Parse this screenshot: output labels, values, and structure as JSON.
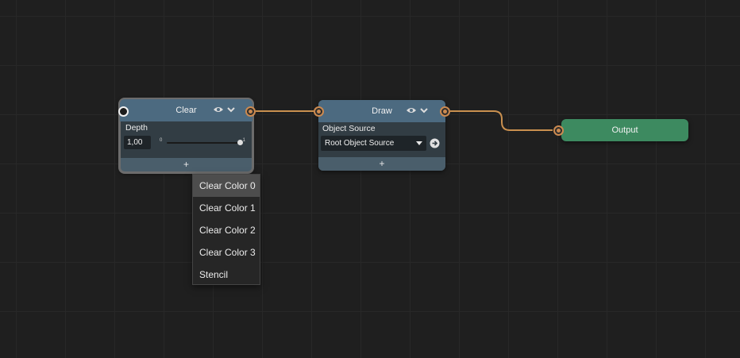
{
  "nodes": {
    "clear": {
      "title": "Clear",
      "depth_label": "Depth",
      "depth_value": "1,00",
      "slider_min": "0",
      "slider_max": "1",
      "slider_fraction": 1.0,
      "add_label": "+"
    },
    "draw": {
      "title": "Draw",
      "object_source_label": "Object Source",
      "object_source_value": "Root Object Source",
      "add_label": "+"
    },
    "output": {
      "title": "Output"
    }
  },
  "dropdown_menu": {
    "items": [
      "Clear Color 0",
      "Clear Color 1",
      "Clear Color 2",
      "Clear Color 3",
      "Stencil"
    ],
    "highlighted": "Clear Color 0"
  },
  "colors": {
    "background": "#1f1f1f",
    "node_header": "#4c6a80",
    "node_body": "#323d44",
    "output_node": "#3d8a60",
    "wire": "#c9904f",
    "port": "#cc8a50"
  },
  "icons": [
    "eye-icon",
    "chevron-down-icon",
    "refresh-icon",
    "dropdown-caret-icon"
  ]
}
